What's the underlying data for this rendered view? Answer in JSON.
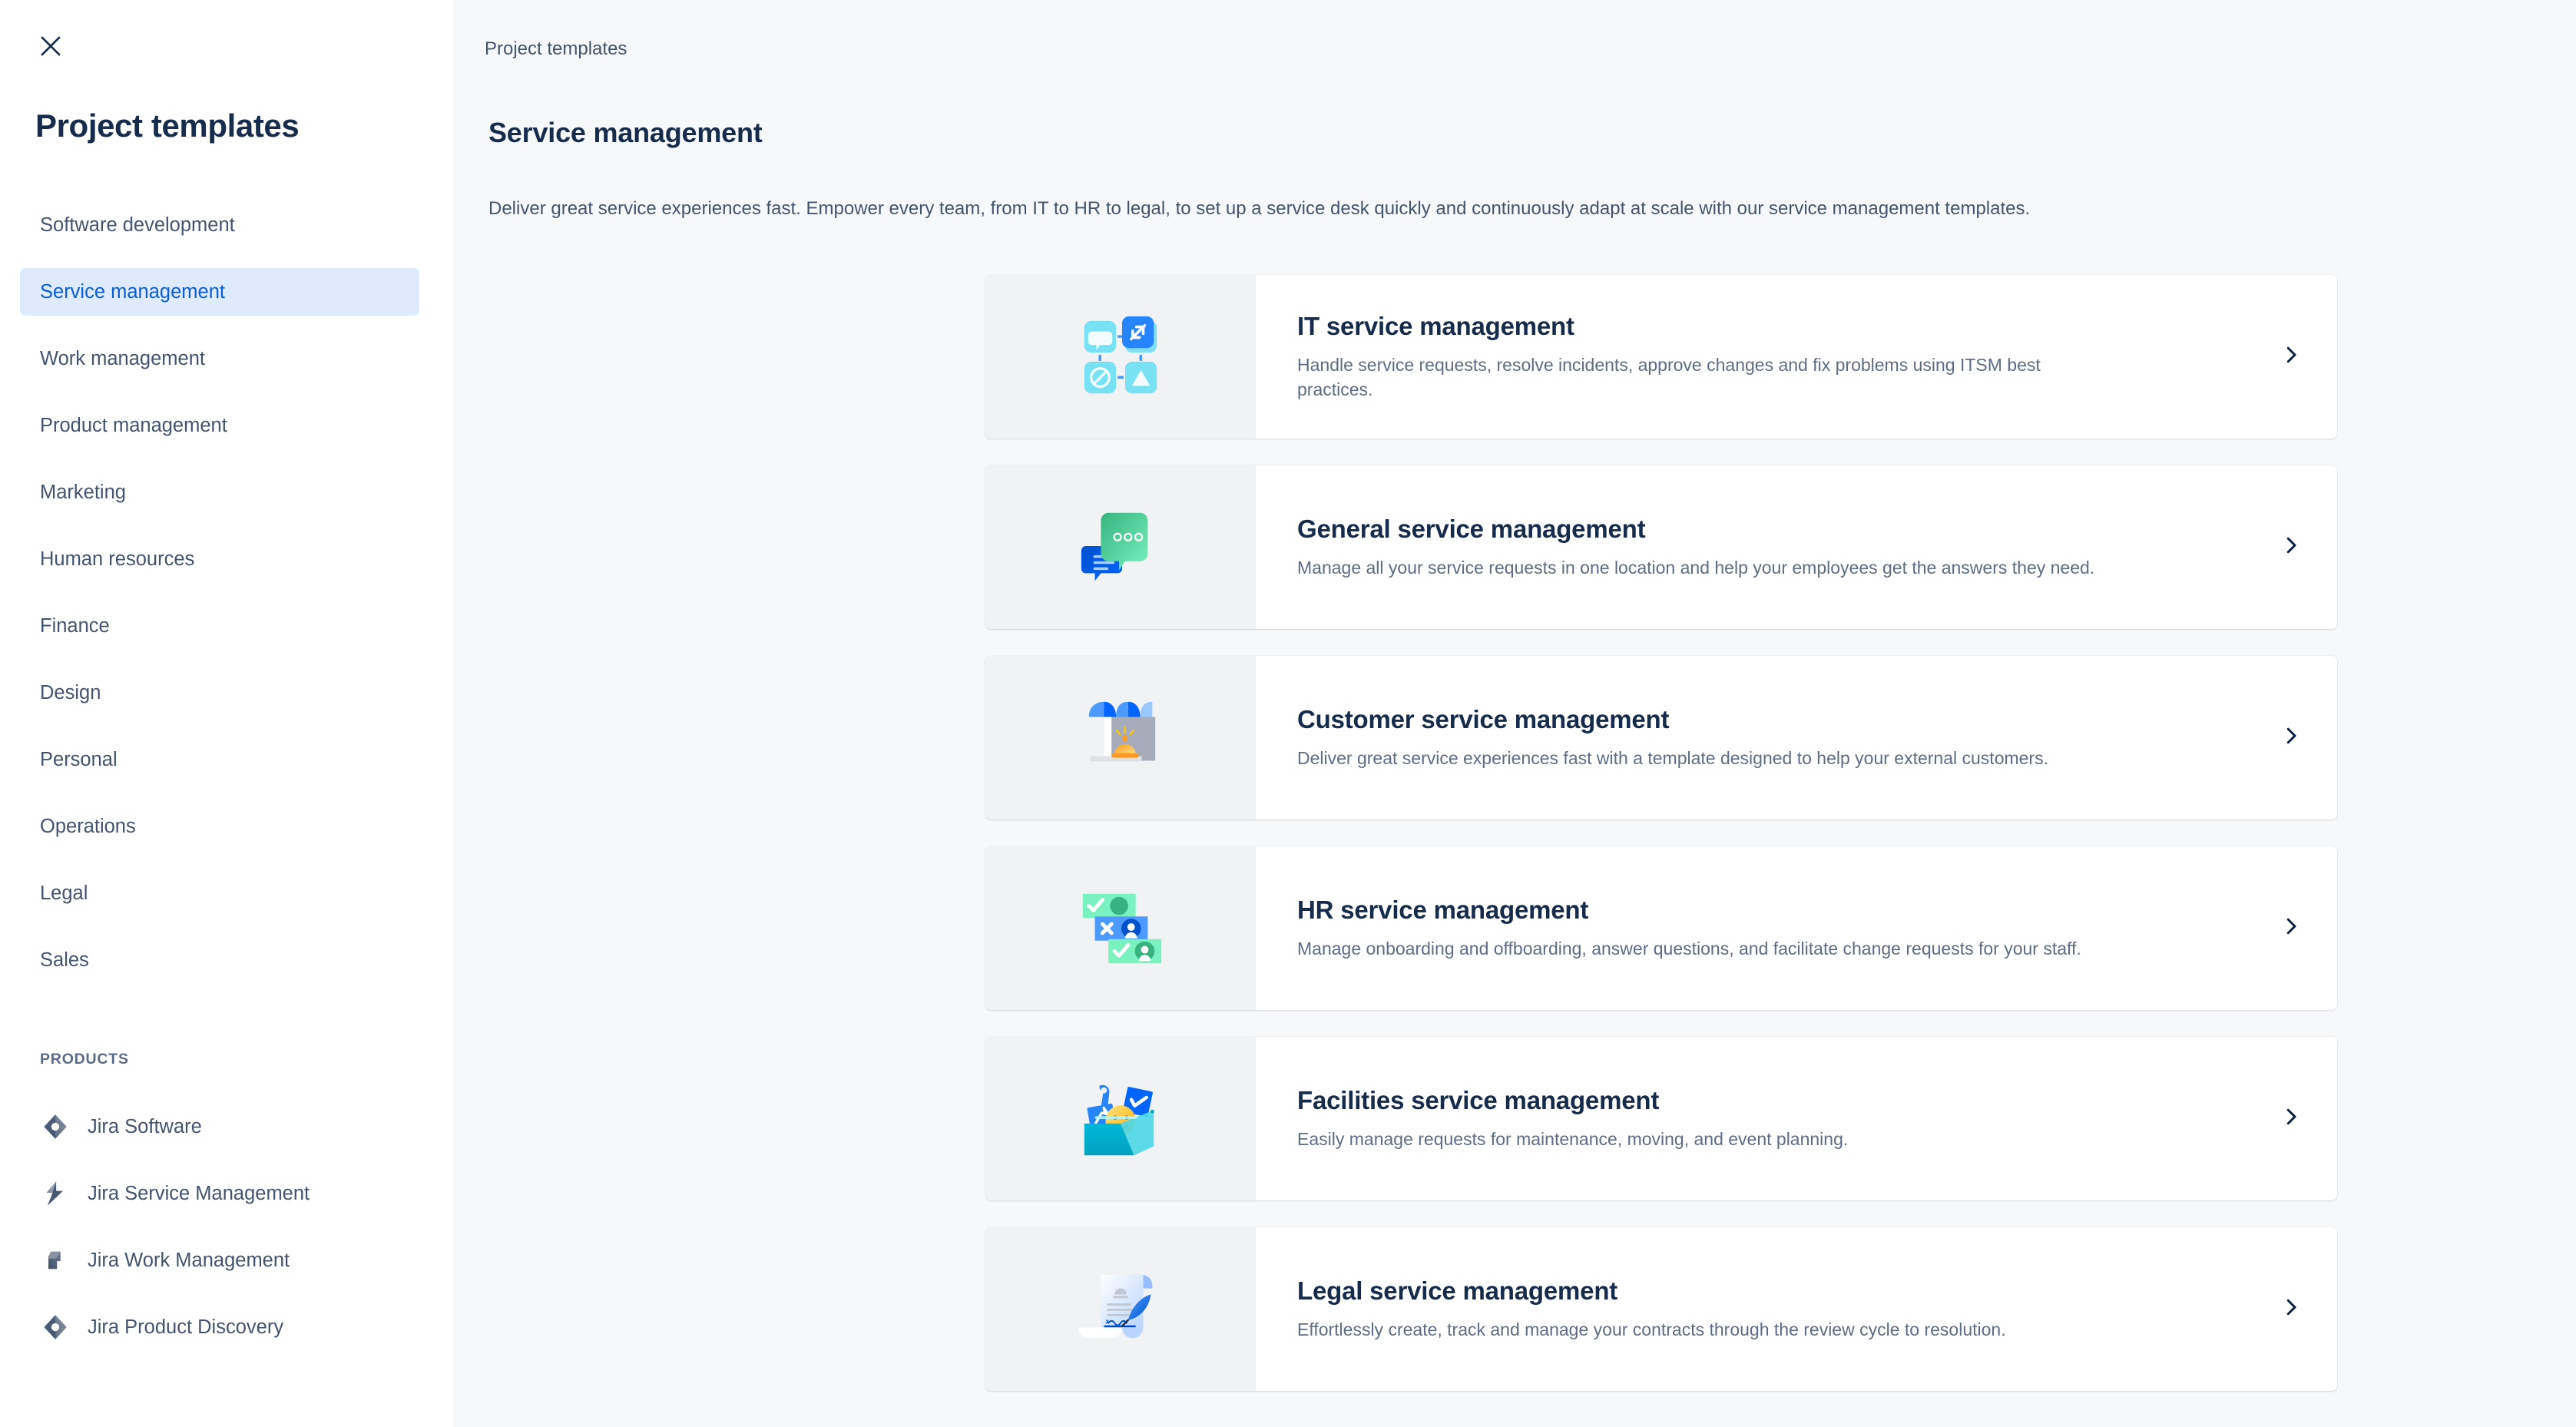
{
  "sidebar": {
    "close_icon": "close-icon",
    "title": "Project templates",
    "items": [
      {
        "label": "Software development",
        "active": false
      },
      {
        "label": "Service management",
        "active": true
      },
      {
        "label": "Work management",
        "active": false
      },
      {
        "label": "Product management",
        "active": false
      },
      {
        "label": "Marketing",
        "active": false
      },
      {
        "label": "Human resources",
        "active": false
      },
      {
        "label": "Finance",
        "active": false
      },
      {
        "label": "Design",
        "active": false
      },
      {
        "label": "Personal",
        "active": false
      },
      {
        "label": "Operations",
        "active": false
      },
      {
        "label": "Legal",
        "active": false
      },
      {
        "label": "Sales",
        "active": false
      }
    ],
    "products_header": "PRODUCTS",
    "products": [
      {
        "label": "Jira Software",
        "icon": "jira-software-icon"
      },
      {
        "label": "Jira Service Management",
        "icon": "jira-service-management-icon"
      },
      {
        "label": "Jira Work Management",
        "icon": "jira-work-management-icon"
      },
      {
        "label": "Jira Product Discovery",
        "icon": "jira-product-discovery-icon"
      }
    ]
  },
  "main": {
    "breadcrumb": "Project templates",
    "title": "Service management",
    "description": "Deliver great service experiences fast. Empower every team, from IT to HR to legal, to set up a service desk quickly and continuously adapt at scale with our service management templates.",
    "chevron_icon": "chevron-right-icon",
    "templates": [
      {
        "title": "IT service management",
        "description": "Handle service requests, resolve incidents, approve changes and fix problems using ITSM best practices.",
        "icon": "itsm-tiles-icon"
      },
      {
        "title": "General service management",
        "description": "Manage all your service requests in one location and help your employees get the answers they need.",
        "icon": "chat-bubbles-icon"
      },
      {
        "title": "Customer service management",
        "description": "Deliver great service experiences fast with a template designed to help your external customers.",
        "icon": "storefront-bell-icon"
      },
      {
        "title": "HR service management",
        "description": "Manage onboarding and offboarding, answer questions, and facilitate change requests for your staff.",
        "icon": "hr-cards-icon"
      },
      {
        "title": "Facilities service management",
        "description": "Easily manage requests for maintenance, moving, and event planning.",
        "icon": "toolbox-icon"
      },
      {
        "title": "Legal service management",
        "description": "Effortlessly create, track and manage your contracts through the review cycle to resolution.",
        "icon": "contract-quill-icon"
      }
    ]
  },
  "colors": {
    "accent": "#0B5CD5",
    "active_nav_bg": "#DEEAFD",
    "text_primary": "#172B4D",
    "text_secondary": "#44546F",
    "text_muted": "#5E6C84",
    "main_bg": "#F7F8FA",
    "card_bg": "#FFFFFF",
    "icon_panel_bg": "#F1F2F4"
  }
}
